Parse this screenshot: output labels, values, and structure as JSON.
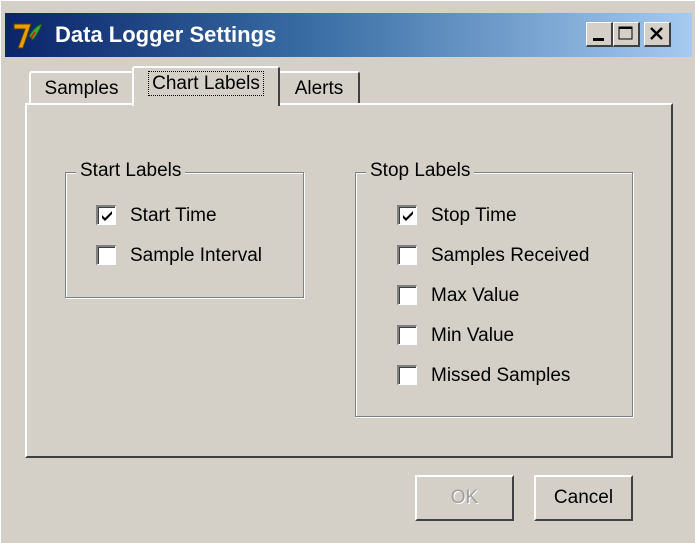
{
  "window": {
    "title": "Data Logger Settings",
    "icon": "app-logo-icon",
    "controls": [
      "minimize-icon",
      "maximize-icon",
      "close-icon"
    ]
  },
  "tabs": [
    {
      "label": "Samples",
      "active": false
    },
    {
      "label": "Chart Labels",
      "active": true
    },
    {
      "label": "Alerts",
      "active": false
    }
  ],
  "start_labels": {
    "title": "Start Labels",
    "items": [
      {
        "label": "Start Time",
        "checked": true
      },
      {
        "label": "Sample Interval",
        "checked": false
      }
    ]
  },
  "stop_labels": {
    "title": "Stop Labels",
    "items": [
      {
        "label": "Stop Time",
        "checked": true
      },
      {
        "label": "Samples Received",
        "checked": false
      },
      {
        "label": "Max Value",
        "checked": false
      },
      {
        "label": "Min Value",
        "checked": false
      },
      {
        "label": "Missed Samples",
        "checked": false
      }
    ]
  },
  "buttons": {
    "ok_label": "OK",
    "ok_enabled": false,
    "cancel_label": "Cancel"
  }
}
